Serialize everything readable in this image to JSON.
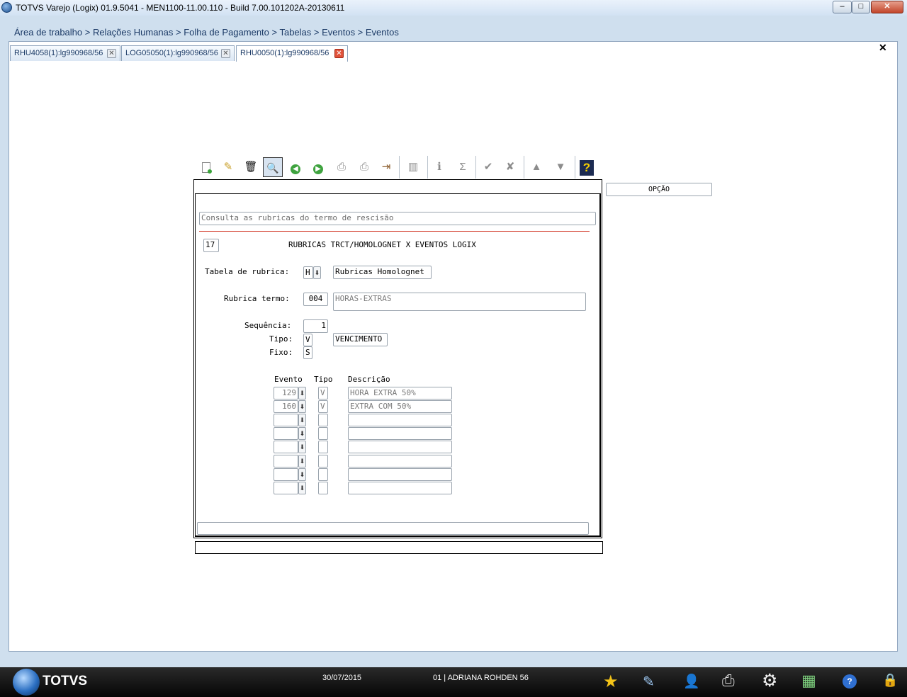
{
  "window": {
    "title": "TOTVS Varejo (Logix) 01.9.5041  -  MEN1100-11.00.110 - Build 7.00.101202A-20130611",
    "min_label": "–",
    "max_label": "□",
    "close_label": "✕"
  },
  "breadcrumb": "Área de trabalho > Relações Humanas > Folha de Pagamento > Tabelas > Eventos > Eventos",
  "tabs": [
    {
      "label": "RHU4058(1):lg990968/56",
      "close": "✕"
    },
    {
      "label": "LOG05050(1):lg990968/56",
      "close": "✕"
    },
    {
      "label": "RHU0050(1):lg990968/56",
      "close": "✕"
    }
  ],
  "main_close": "✕",
  "toolbar": {
    "icons": [
      "new-icon",
      "edit-icon",
      "delete-icon",
      "search-icon",
      "previous-icon",
      "next-icon",
      "print-icon",
      "print-disabled-icon",
      "exit-icon",
      "columns-icon",
      "info-icon",
      "sum-icon",
      "confirm-icon",
      "cancel-icon",
      "up-icon",
      "down-icon",
      "help-icon"
    ],
    "glyphs": {
      "edit": "✎",
      "delete": "🗑",
      "search": "🔍",
      "prev": "◀",
      "next": "▶",
      "print": "⎙",
      "print2": "⎙",
      "exit": "⇥",
      "columns": "▥",
      "info": "ℹ",
      "sum": "Σ",
      "confirm": "✔",
      "cancel": "✘",
      "up": "▲",
      "down": "▼",
      "help": "?"
    }
  },
  "opcao": "OPÇÃO",
  "form": {
    "message": "Consulta as rubricas do termo de rescisão",
    "program_number": "17",
    "title": "RUBRICAS TRCT/HOMOLOGNET X EVENTOS LOGIX",
    "tabela_label": "Tabela de rubrica:",
    "tabela_value": "H",
    "tabela_desc": "Rubricas Homolognet",
    "rubrica_label": "Rubrica termo:",
    "rubrica_value": "004",
    "rubrica_desc": "HORAS-EXTRAS",
    "sequencia_label": "Sequência:",
    "sequencia_value": "1",
    "tipo_label": "Tipo:",
    "tipo_value": "V",
    "tipo_desc": "VENCIMENTO",
    "fixo_label": "Fixo:",
    "fixo_value": "S",
    "zoom_glyph": "⬇",
    "grid": {
      "headers": [
        "Evento",
        "Tipo",
        "Descrição"
      ],
      "rows": [
        {
          "evento": "129",
          "tipo": "V",
          "descricao": "HORA EXTRA 50%"
        },
        {
          "evento": "160",
          "tipo": "V",
          "descricao": "EXTRA COM 50%"
        },
        {
          "evento": "",
          "tipo": "",
          "descricao": ""
        },
        {
          "evento": "",
          "tipo": "",
          "descricao": ""
        },
        {
          "evento": "",
          "tipo": "",
          "descricao": ""
        },
        {
          "evento": "",
          "tipo": "",
          "descricao": ""
        },
        {
          "evento": "",
          "tipo": "",
          "descricao": ""
        },
        {
          "evento": "",
          "tipo": "",
          "descricao": ""
        }
      ]
    }
  },
  "taskbar": {
    "brand": "TOTVS",
    "date": "30/07/2015",
    "user": "01 | ADRIANA ROHDEN 56",
    "icons": [
      "favorites-star-icon",
      "edit-document-icon",
      "user-icon",
      "printer-icon",
      "settings-gear-icon",
      "chart-icon",
      "help-icon",
      "lock-icon"
    ],
    "glyphs": {
      "star": "★",
      "doc": "✎",
      "user": "👤",
      "print": "⎙",
      "gear": "⚙",
      "chart": "▦",
      "help": "?",
      "lock": "🔒"
    }
  },
  "colors": {
    "background": "#cfdfee",
    "taskbar": "#0d0d0d",
    "accent_red": "#d23a2a",
    "tab_text": "#1b3a66"
  }
}
